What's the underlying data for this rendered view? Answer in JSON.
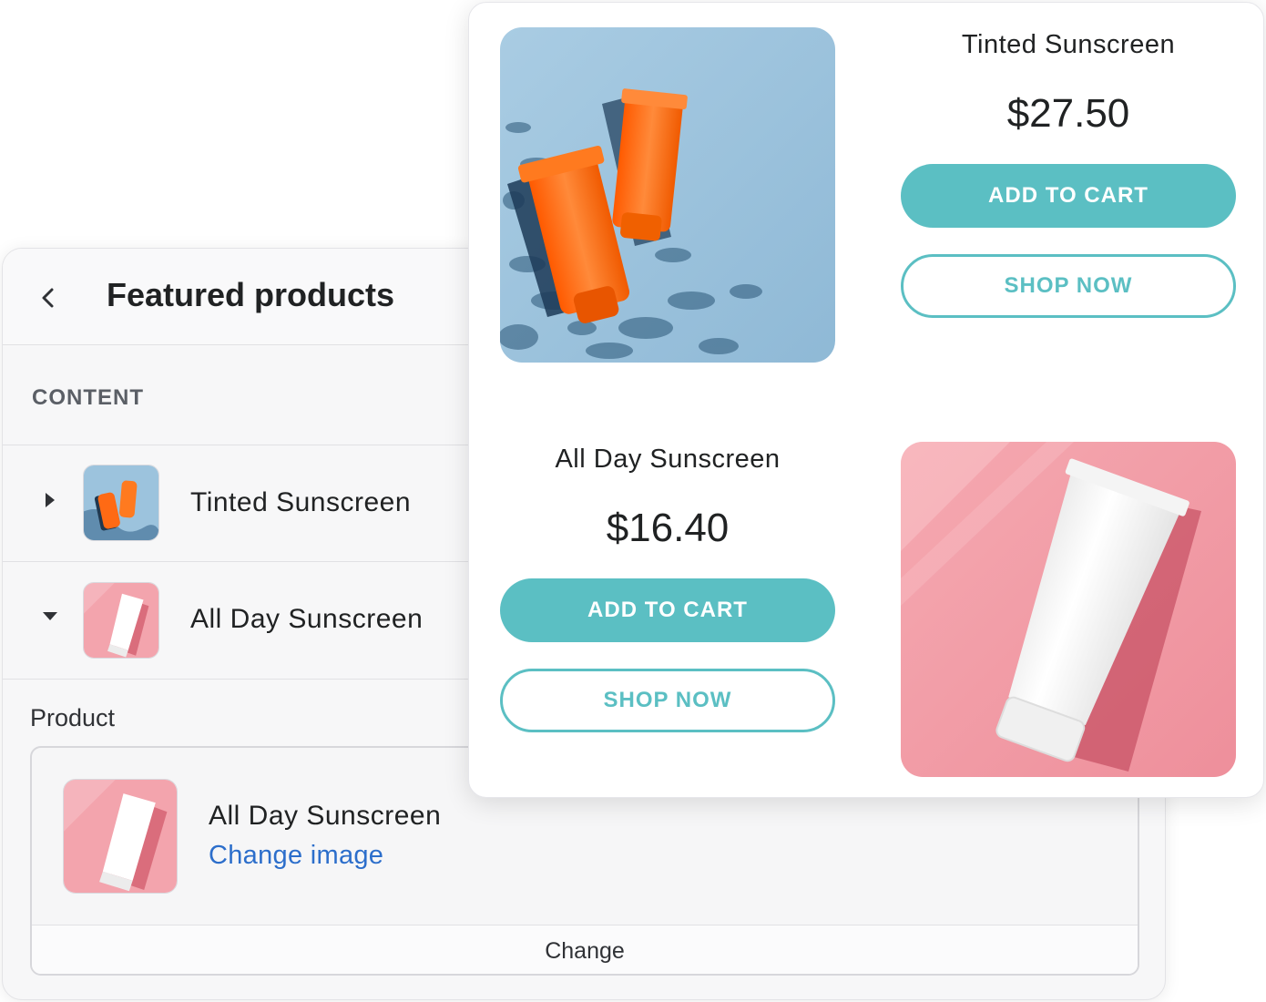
{
  "editor": {
    "title": "Featured products",
    "section_label": "CONTENT",
    "items": [
      {
        "label": "Tinted Sunscreen",
        "expanded": false,
        "thumb": "orange-tubes-blue-bg"
      },
      {
        "label": "All Day Sunscreen",
        "expanded": true,
        "thumb": "white-tube-pink-bg"
      }
    ],
    "product_label": "Product",
    "selected_product": {
      "name": "All Day Sunscreen",
      "change_image_label": "Change image",
      "change_label": "Change"
    }
  },
  "preview": {
    "products": [
      {
        "title": "Tinted Sunscreen",
        "price": "$27.50",
        "add_to_cart": "ADD TO CART",
        "shop_now": "SHOP NOW"
      },
      {
        "title": "All Day Sunscreen",
        "price": "$16.40",
        "add_to_cart": "ADD TO CART",
        "shop_now": "SHOP NOW"
      }
    ]
  },
  "colors": {
    "accent_teal": "#5bbfc3",
    "link_blue": "#2c6ecb",
    "blue_bg": "#9cc3dd",
    "pink_bg": "#f3a4ad",
    "orange": "#ff6a14"
  },
  "icons": [
    "chevron-left-icon",
    "caret-right-icon",
    "caret-down-icon"
  ]
}
